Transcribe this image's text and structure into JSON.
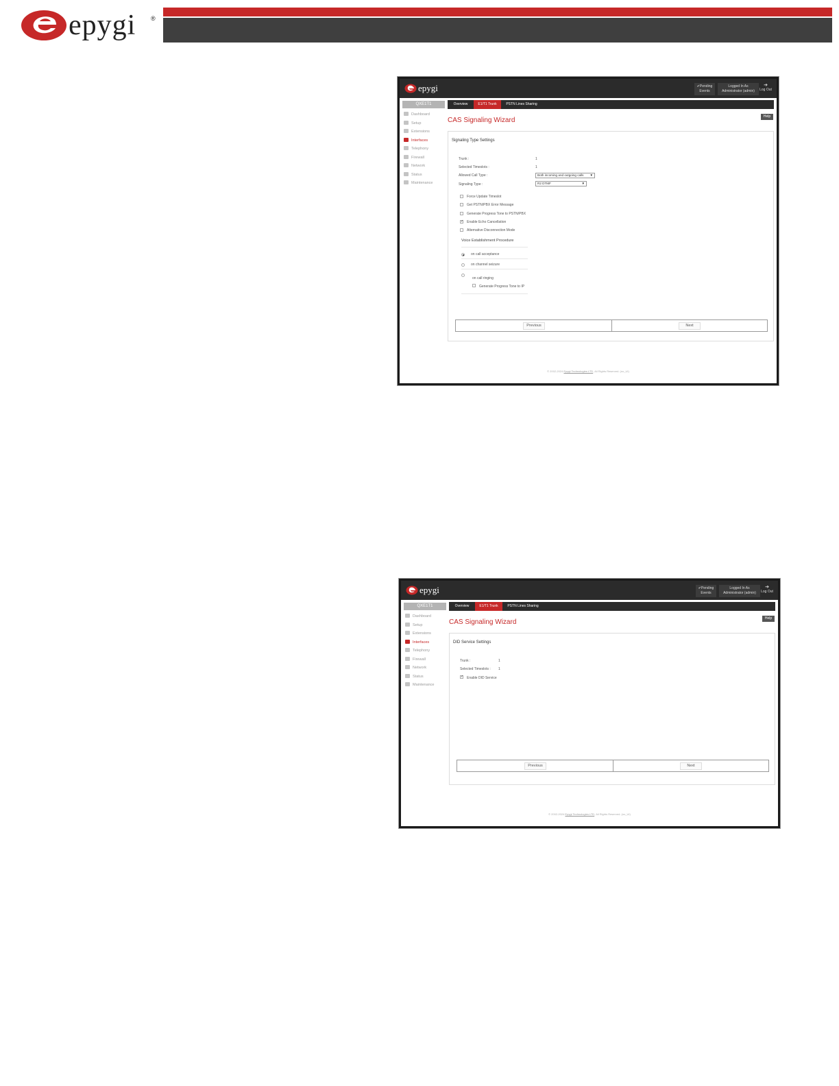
{
  "header": {
    "brand": "epygi",
    "registered": "®",
    "colors": {
      "accent": "#c62828",
      "bar": "#3f3f3f"
    }
  },
  "screens": [
    {
      "app": {
        "brand": "epygi",
        "pending": [
          "✔Pending",
          "Events"
        ],
        "logged": [
          "Logged In As",
          "Administrator (admin)"
        ],
        "logout": [
          "➔",
          "Log Out"
        ]
      },
      "sidebar": {
        "title": "QXE1T1",
        "items": [
          "Dashboard",
          "Setup",
          "Extensions",
          "Interfaces",
          "Telephony",
          "Firewall",
          "Network",
          "Status",
          "Maintenance"
        ]
      },
      "tabs": [
        "Overview",
        "E1/T1 Trunk",
        "PSTN Lines Sharing"
      ],
      "help": "Help",
      "title": "CAS Signaling Wizard",
      "section": "Signaling Type Settings",
      "fields": {
        "trunk_label": "Trunk :",
        "trunk_value": "1",
        "timeslots_label": "Selected Timeslots :",
        "timeslots_value": "1",
        "call_type_label": "Allowed Call Type :",
        "call_type_value": "Both incoming and outgoing calls",
        "signaling_label": "Signaling Type :",
        "signaling_value": "R2 DTMF"
      },
      "checkboxes": [
        {
          "label": "Force Update Timeslot",
          "checked": false
        },
        {
          "label": "Get PSTN/PBX Error Message",
          "checked": false
        },
        {
          "label": "Generate Progress Tone to PSTN/PBX",
          "checked": false
        },
        {
          "label": "Enable Echo Cancellation",
          "checked": true
        },
        {
          "label": "Alternative Disconnection Mode",
          "checked": false
        }
      ],
      "voice": {
        "title": "Voice Establishment Procedure",
        "options": [
          "on call acceptance",
          "on channel seizure",
          "on call ringing"
        ],
        "sub_checkbox": "Generate Progress Tone to IP"
      },
      "nav": {
        "previous": "Previous",
        "next": "Next"
      },
      "footer": {
        "prefix": "© 2002-2024 ",
        "link": "Epygi Technologies LTD",
        "suffix": ", All Rights Reserved. (no_UI)"
      }
    },
    {
      "app": {
        "brand": "epygi",
        "pending": [
          "✔Pending",
          "Events"
        ],
        "logged": [
          "Logged In As",
          "Administrator (admin)"
        ],
        "logout": [
          "➔",
          "Log Out"
        ]
      },
      "sidebar": {
        "title": "QXE1T1",
        "items": [
          "Dashboard",
          "Setup",
          "Extensions",
          "Interfaces",
          "Telephony",
          "Firewall",
          "Network",
          "Status",
          "Maintenance"
        ]
      },
      "tabs": [
        "Overview",
        "E1/T1 Trunk",
        "PSTN Lines Sharing"
      ],
      "help": "Help",
      "title": "CAS Signaling Wizard",
      "section": "DID Service Settings",
      "fields": {
        "trunk_label": "Trunk :",
        "trunk_value": "1",
        "timeslots_label": "Selected Timeslots :",
        "timeslots_value": "1"
      },
      "checkboxes": [
        {
          "label": "Enable DID Service",
          "checked": true
        }
      ],
      "nav": {
        "previous": "Previous",
        "next": "Next"
      },
      "footer": {
        "prefix": "© 2002-2024 ",
        "link": "Epygi Technologies LTD",
        "suffix": ", All Rights Reserved. (no_UI)"
      }
    }
  ]
}
